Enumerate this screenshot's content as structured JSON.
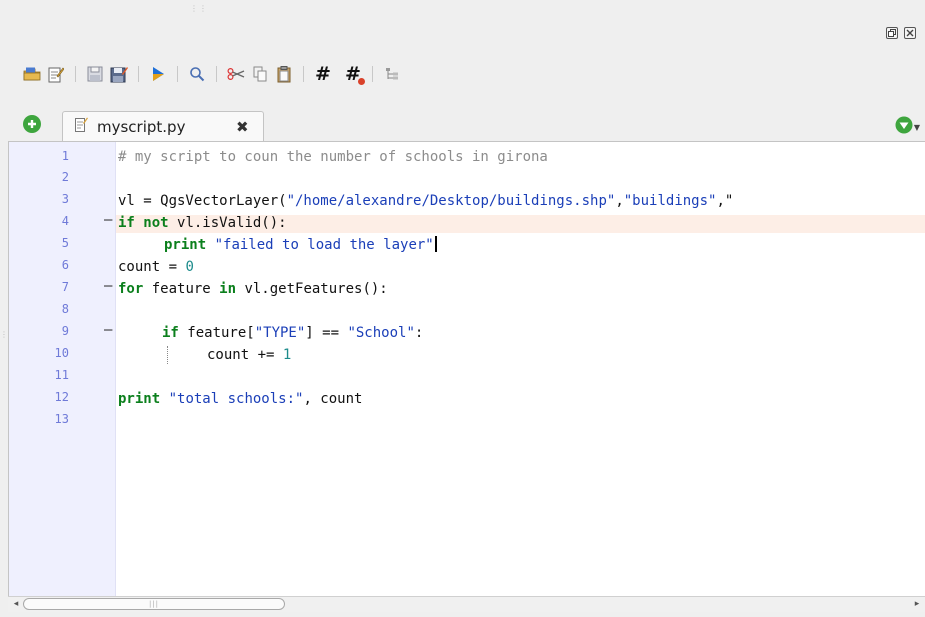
{
  "toolbar": {
    "buttons": [
      {
        "name": "open-file-icon"
      },
      {
        "name": "open-in-external-editor-icon"
      },
      {
        "name": "save-icon"
      },
      {
        "name": "save-as-icon"
      },
      {
        "name": "run-script-icon"
      },
      {
        "name": "find-text-icon"
      },
      {
        "name": "cut-icon"
      },
      {
        "name": "copy-icon"
      },
      {
        "name": "paste-icon"
      },
      {
        "name": "comment-icon",
        "glyph": "#"
      },
      {
        "name": "uncomment-icon",
        "glyph": "#"
      },
      {
        "name": "object-inspector-icon"
      }
    ]
  },
  "tabs": [
    {
      "label": "myscript.py",
      "close_glyph": "✖"
    }
  ],
  "editor": {
    "line_numbers": [
      "1",
      "2",
      "3",
      "4",
      "5",
      "6",
      "7",
      "8",
      "9",
      "10",
      "11",
      "12",
      "13"
    ],
    "fold_markers": {
      "4": "–",
      "7": "–",
      "9": "–"
    },
    "current_line": 5,
    "lines": {
      "l1": "# my script to coun the number of schools in girona",
      "l3_a": "vl = QgsVectorLayer(",
      "l3_b": "\"/home/alexandre/Desktop/buildings.shp\"",
      "l3_c": ",",
      "l3_d": "\"buildings\"",
      "l3_e": ",\"",
      "l4_kw1": "if",
      "l4_kw2": "not",
      "l4_rest": " vl.isValid():",
      "l5_kw": "print",
      "l5_str": "\"failed to load the layer\"",
      "l6_a": "count = ",
      "l6_num": "0",
      "l7_kw1": "for",
      "l7_mid": " feature ",
      "l7_kw2": "in",
      "l7_rest": " vl.getFeatures():",
      "l9_kw": "if",
      "l9_a": " feature[",
      "l9_str1": "\"TYPE\"",
      "l9_b": "] == ",
      "l9_str2": "\"School\"",
      "l9_c": ":",
      "l10_a": "count += ",
      "l10_num": "1",
      "l12_kw": "print",
      "l12_str": "\"total schools:\"",
      "l12_rest": ", count"
    }
  },
  "colors": {
    "keyword": "#0b7f1c",
    "string": "#1b3fb8",
    "number": "#1c8b8b",
    "comment": "#8c8c8c",
    "line_number": "#6f7ad8",
    "current_line_bg": "#fdeee6",
    "gutter_bg": "#eff0fe"
  }
}
